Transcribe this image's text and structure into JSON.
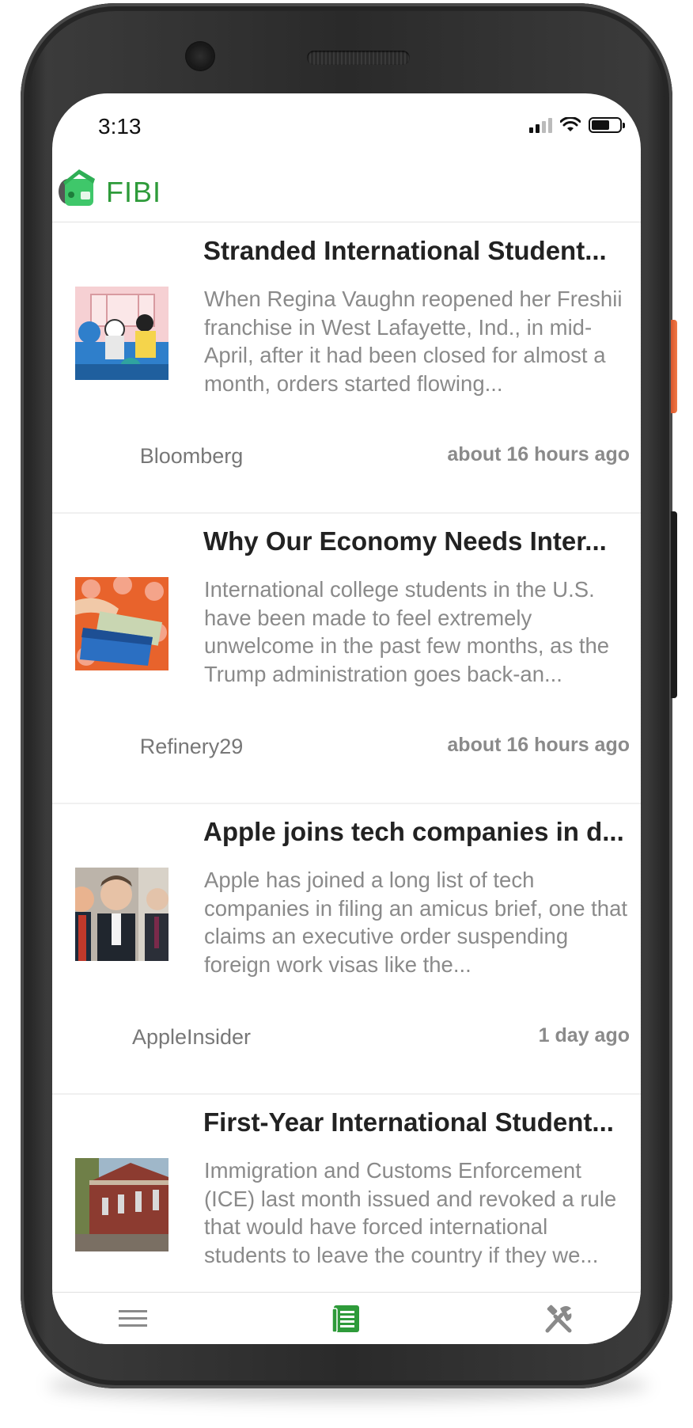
{
  "status_bar": {
    "time": "3:13"
  },
  "header": {
    "title": "FIBI"
  },
  "theme": {
    "accent": "#2e9b3a"
  },
  "news": [
    {
      "title": "Stranded International Student...",
      "summary": "When Regina Vaughn reopened her Freshii franchise in West Lafayette, Ind., in mid-April, after it had been closed for almost a month, orders started flowing...",
      "source": "Bloomberg",
      "time": "about 16 hours ago",
      "thumbnail": "illustration-masked-people"
    },
    {
      "title": "Why Our Economy Needs Inter...",
      "summary": "International college students in the U.S. have been made to feel extremely unwelcome in the past few months, as the Trump administration goes back-an...",
      "source": "Refinery29",
      "time": "about 16 hours ago",
      "thumbnail": "wallet-with-money"
    },
    {
      "title": "Apple joins tech companies in d...",
      "summary": "Apple has joined a long list of tech companies in filing an amicus brief, one that claims an executive order suspending foreign work visas like the...",
      "source": "AppleInsider",
      "time": "1 day ago",
      "thumbnail": "men-in-suits"
    },
    {
      "title": "First-Year International Student...",
      "summary": "Immigration and Customs Enforcement (ICE) last month issued and revoked a rule that would have forced international students to leave the country if they we...",
      "source": "",
      "time": "",
      "thumbnail": "brick-building"
    }
  ],
  "tabs": [
    {
      "icon": "menu-icon",
      "active": false
    },
    {
      "icon": "news-icon",
      "active": true
    },
    {
      "icon": "tools-icon",
      "active": false
    }
  ]
}
